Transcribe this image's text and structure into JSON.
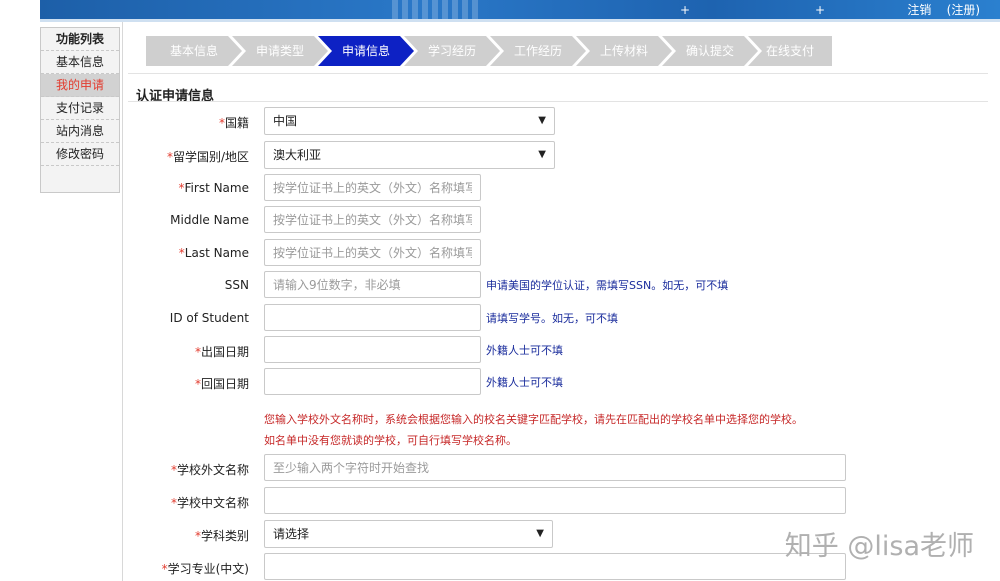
{
  "header": {
    "user_text": "注销    (注册)"
  },
  "sidebar": {
    "title": "功能列表",
    "items": [
      {
        "label": "基本信息"
      },
      {
        "label": "我的申请",
        "active": true
      },
      {
        "label": "支付记录"
      },
      {
        "label": "站内消息"
      },
      {
        "label": "修改密码"
      }
    ]
  },
  "steps": [
    {
      "label": "基本信息"
    },
    {
      "label": "申请类型"
    },
    {
      "label": "申请信息",
      "active": true
    },
    {
      "label": "学习经历"
    },
    {
      "label": "工作经历"
    },
    {
      "label": "上传材料"
    },
    {
      "label": "确认提交"
    },
    {
      "label": "在线支付"
    }
  ],
  "section_title": "认证申请信息",
  "form": {
    "nationality": {
      "label": "国籍",
      "required": true,
      "value": "中国"
    },
    "study_country": {
      "label": "留学国别/地区",
      "required": true,
      "value": "澳大利亚"
    },
    "first_name": {
      "label": "First Name",
      "required": true,
      "placeholder": "按学位证书上的英文（外文）名称填写"
    },
    "middle_name": {
      "label": "Middle Name",
      "required": false,
      "placeholder": "按学位证书上的英文（外文）名称填写"
    },
    "last_name": {
      "label": "Last Name",
      "required": true,
      "placeholder": "按学位证书上的英文（外文）名称填写"
    },
    "ssn": {
      "label": "SSN",
      "required": false,
      "placeholder": "请输入9位数字，非必填",
      "hint": "申请美国的学位认证，需填写SSN。如无，可不填"
    },
    "student_id": {
      "label": "ID of Student",
      "required": false,
      "placeholder": "",
      "hint": "请填写学号。如无，可不填"
    },
    "departure_date": {
      "label": "出国日期",
      "required": true,
      "hint": "外籍人士可不填"
    },
    "return_date": {
      "label": "回国日期",
      "required": true,
      "hint": "外籍人士可不填"
    },
    "school_note_1": "您输入学校外文名称时，系统会根据您输入的校名关键字匹配学校，请先在匹配出的学校名单中选择您的学校。",
    "school_note_2": "如名单中没有您就读的学校，可自行填写学校名称。",
    "school_foreign": {
      "label": "学校外文名称",
      "required": true,
      "placeholder": "至少输入两个字符时开始查找"
    },
    "school_chinese": {
      "label": "学校中文名称",
      "required": true,
      "placeholder": ""
    },
    "subject_category": {
      "label": "学科类别",
      "required": true,
      "value": "请选择"
    },
    "major_cn": {
      "label": "学习专业(中文)",
      "required": true,
      "placeholder": ""
    }
  },
  "watermark": "知乎 @lisa老师",
  "colors": {
    "active_step": "#0d21c4",
    "inactive_step": "#cfcfcf",
    "required": "#e23b2e",
    "hint": "#1a2c9c",
    "warning": "#c62828"
  }
}
